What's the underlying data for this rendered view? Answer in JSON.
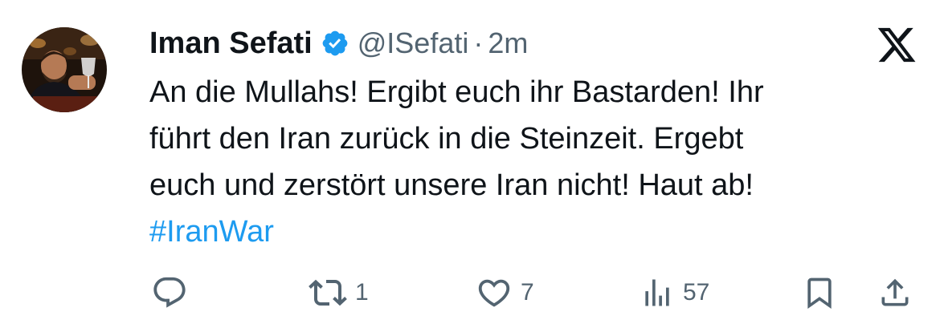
{
  "tweet": {
    "author_name": "Iman Sefati",
    "handle": "@ISefati",
    "separator": "·",
    "time": "2m",
    "text_lines": [
      "An die Mullahs! Ergibt euch ihr Bastarden!  Ihr",
      "führt den Iran zurück in die Steinzeit. Ergebt",
      "euch und zerstört unsere Iran nicht! Haut ab!"
    ],
    "hashtag": "#IranWar"
  },
  "actions": {
    "reply_icon": "reply-icon",
    "retweet_icon": "retweet-icon",
    "retweet_count": "1",
    "like_icon": "heart-icon",
    "like_count": "7",
    "views_icon": "views-bar-chart-icon",
    "views_count": "57",
    "bookmark_icon": "bookmark-icon",
    "share_icon": "share-icon"
  },
  "colors": {
    "text": "#0f1419",
    "secondary": "#536471",
    "accent": "#1d9bf0"
  }
}
